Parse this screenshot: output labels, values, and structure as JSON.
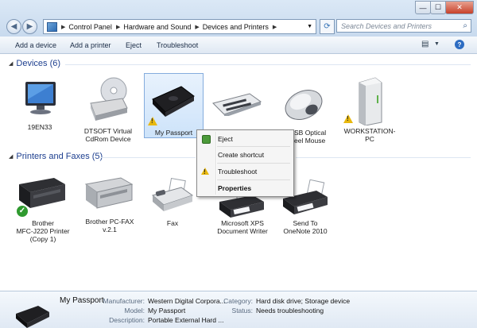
{
  "window": {
    "min_glyph": "—",
    "max_glyph": "☐",
    "close_glyph": "✕"
  },
  "address": {
    "crumbs": [
      "Control Panel",
      "Hardware and Sound",
      "Devices and Printers"
    ],
    "search_placeholder": "Search Devices and Printers"
  },
  "toolbar": {
    "add_device": "Add a device",
    "add_printer": "Add a printer",
    "eject": "Eject",
    "troubleshoot": "Troubleshoot"
  },
  "groups": {
    "devices_header": "Devices (6)",
    "printers_header": "Printers and Faxes (5)"
  },
  "devices": [
    {
      "label": "19EN33"
    },
    {
      "label": "DTSOFT Virtual\nCdRom Device"
    },
    {
      "label": "My Passport"
    },
    {
      "label": ""
    },
    {
      "label": "SB Optical\neel Mouse"
    },
    {
      "label": "WORKSTATION-\nPC"
    }
  ],
  "printers": [
    {
      "label": "Brother\nMFC-J220 Printer\n(Copy 1)"
    },
    {
      "label": "Brother PC-FAX\nv.2.1"
    },
    {
      "label": "Fax"
    },
    {
      "label": "Microsoft XPS\nDocument Writer"
    },
    {
      "label": "Send To\nOneNote 2010"
    }
  ],
  "context_menu": {
    "eject": "Eject",
    "create_shortcut": "Create shortcut",
    "troubleshoot": "Troubleshoot",
    "properties": "Properties"
  },
  "details": {
    "name": "My Passport",
    "manufacturer_label": "Manufacturer:",
    "manufacturer": "Western Digital Corpora...",
    "model_label": "Model:",
    "model": "My Passport",
    "description_label": "Description:",
    "description": "Portable External Hard ...",
    "category_label": "Category:",
    "category": "Hard disk drive; Storage device",
    "status_label": "Status:",
    "status": "Needs troubleshooting"
  },
  "colors": {
    "header_blue": "#1d3f8f",
    "selection": "#cde3fa",
    "warning": "#e8b80e",
    "ok_green": "#2f9a2f"
  }
}
